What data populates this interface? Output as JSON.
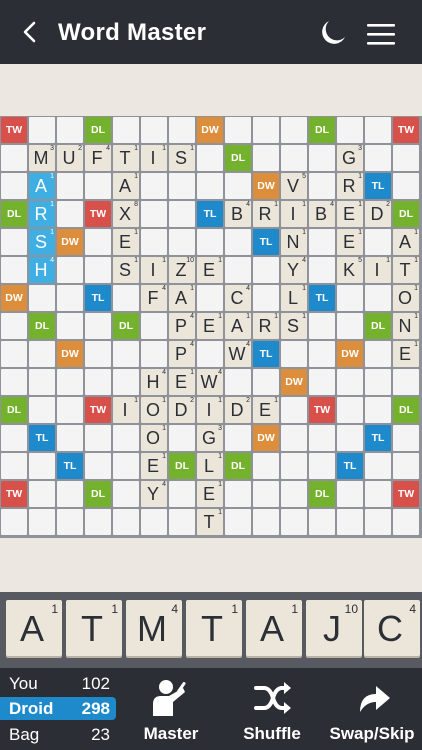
{
  "header": {
    "title": "Word Master",
    "back_icon": "chevron-left-icon",
    "theme_icon": "moon-icon",
    "menu_icon": "hamburger-menu-icon"
  },
  "board": {
    "size": 15,
    "colors": {
      "triple_word": "#d8504a",
      "double_word": "#dd8e3c",
      "triple_letter": "#1e8acb",
      "double_letter": "#74b12d",
      "last_move": "#3faee3",
      "tile": "#ece6da",
      "empty": "#f4f4f4"
    },
    "bonus_labels": {
      "tw": "TW",
      "dw": "DW",
      "tl": "TL",
      "dl": "DL"
    },
    "bonus_rows": [
      "tw . . dl . . . dw . . . dl . . tw",
      ". . . . . . . . dl . . . . . .",
      ". . . . . . . . . dw . . . tl .",
      "dl . . tw . . . tl . . . . . . dl",
      ". . dw . . . . . . tl . . . . .",
      ". dl . . dl . . . . . . . . dl .",
      "dw . . tl . . . . . . . tl . . .",
      ". dl . . dl . . . . . dl . . dl .",
      ". . dw . . . . . . tl . . dw . .",
      ". . . . . . . . . . dw . . . .",
      "dl . . tw . . . . . . . tw . . dl",
      ". tl . . . . . . . dw . . . tl .",
      ". . tl . . . dl . dl . . . tl . .",
      "tw . . dl . . . . . . . dl . . tw",
      ". . . . . . . . . . . . . . ."
    ],
    "blue_cells": [
      [
        2,
        1
      ],
      [
        3,
        1
      ],
      [
        4,
        1
      ],
      [
        5,
        1
      ]
    ],
    "tiles": [
      {
        "r": 1,
        "c": 1,
        "l": "M",
        "p": "3"
      },
      {
        "r": 1,
        "c": 2,
        "l": "U",
        "p": "2"
      },
      {
        "r": 1,
        "c": 3,
        "l": "F",
        "p": "4"
      },
      {
        "r": 1,
        "c": 4,
        "l": "T",
        "p": "1"
      },
      {
        "r": 1,
        "c": 5,
        "l": "I",
        "p": "1"
      },
      {
        "r": 1,
        "c": 6,
        "l": "S",
        "p": "1"
      },
      {
        "r": 1,
        "c": 12,
        "l": "G",
        "p": "3"
      },
      {
        "r": 2,
        "c": 1,
        "l": "A",
        "p": "1"
      },
      {
        "r": 2,
        "c": 4,
        "l": "A",
        "p": "1"
      },
      {
        "r": 2,
        "c": 10,
        "l": "V",
        "p": "5"
      },
      {
        "r": 2,
        "c": 12,
        "l": "R",
        "p": "1"
      },
      {
        "r": 3,
        "c": 1,
        "l": "R",
        "p": "1"
      },
      {
        "r": 3,
        "c": 4,
        "l": "X",
        "p": "8"
      },
      {
        "r": 3,
        "c": 8,
        "l": "B",
        "p": "4"
      },
      {
        "r": 3,
        "c": 9,
        "l": "R",
        "p": "1"
      },
      {
        "r": 3,
        "c": 10,
        "l": "I",
        "p": "1"
      },
      {
        "r": 3,
        "c": 11,
        "l": "B",
        "p": "4"
      },
      {
        "r": 3,
        "c": 12,
        "l": "E",
        "p": "1"
      },
      {
        "r": 3,
        "c": 13,
        "l": "D",
        "p": "2"
      },
      {
        "r": 4,
        "c": 1,
        "l": "S",
        "p": "1"
      },
      {
        "r": 4,
        "c": 4,
        "l": "E",
        "p": "1"
      },
      {
        "r": 4,
        "c": 10,
        "l": "N",
        "p": "1"
      },
      {
        "r": 4,
        "c": 12,
        "l": "E",
        "p": "1"
      },
      {
        "r": 4,
        "c": 14,
        "l": "A",
        "p": "1"
      },
      {
        "r": 5,
        "c": 1,
        "l": "H",
        "p": "4"
      },
      {
        "r": 5,
        "c": 4,
        "l": "S",
        "p": "1"
      },
      {
        "r": 5,
        "c": 5,
        "l": "I",
        "p": "1"
      },
      {
        "r": 5,
        "c": 6,
        "l": "Z",
        "p": "10"
      },
      {
        "r": 5,
        "c": 7,
        "l": "E",
        "p": "1"
      },
      {
        "r": 5,
        "c": 10,
        "l": "Y",
        "p": "4"
      },
      {
        "r": 5,
        "c": 12,
        "l": "K",
        "p": "5"
      },
      {
        "r": 5,
        "c": 13,
        "l": "I",
        "p": "1"
      },
      {
        "r": 5,
        "c": 14,
        "l": "T",
        "p": "1"
      },
      {
        "r": 6,
        "c": 5,
        "l": "F",
        "p": "4"
      },
      {
        "r": 6,
        "c": 6,
        "l": "A",
        "p": "1"
      },
      {
        "r": 6,
        "c": 8,
        "l": "C",
        "p": "4"
      },
      {
        "r": 6,
        "c": 10,
        "l": "L",
        "p": "1"
      },
      {
        "r": 6,
        "c": 14,
        "l": "O",
        "p": "1"
      },
      {
        "r": 7,
        "c": 6,
        "l": "P",
        "p": "4"
      },
      {
        "r": 7,
        "c": 7,
        "l": "E",
        "p": "1"
      },
      {
        "r": 7,
        "c": 8,
        "l": "A",
        "p": "1"
      },
      {
        "r": 7,
        "c": 9,
        "l": "R",
        "p": "1"
      },
      {
        "r": 7,
        "c": 10,
        "l": "S",
        "p": "1"
      },
      {
        "r": 7,
        "c": 14,
        "l": "N",
        "p": "1"
      },
      {
        "r": 8,
        "c": 6,
        "l": "P",
        "p": "4"
      },
      {
        "r": 8,
        "c": 8,
        "l": "W",
        "p": "4"
      },
      {
        "r": 8,
        "c": 14,
        "l": "E",
        "p": "1"
      },
      {
        "r": 9,
        "c": 5,
        "l": "H",
        "p": "4"
      },
      {
        "r": 9,
        "c": 6,
        "l": "E",
        "p": "1"
      },
      {
        "r": 9,
        "c": 7,
        "l": "W",
        "p": "4"
      },
      {
        "r": 10,
        "c": 4,
        "l": "I",
        "p": "1"
      },
      {
        "r": 10,
        "c": 5,
        "l": "O",
        "p": "1"
      },
      {
        "r": 10,
        "c": 6,
        "l": "D",
        "p": "2"
      },
      {
        "r": 10,
        "c": 7,
        "l": "I",
        "p": "1"
      },
      {
        "r": 10,
        "c": 8,
        "l": "D",
        "p": "2"
      },
      {
        "r": 10,
        "c": 9,
        "l": "E",
        "p": "1"
      },
      {
        "r": 11,
        "c": 5,
        "l": "O",
        "p": "1"
      },
      {
        "r": 11,
        "c": 7,
        "l": "G",
        "p": "3"
      },
      {
        "r": 12,
        "c": 5,
        "l": "E",
        "p": "1"
      },
      {
        "r": 12,
        "c": 7,
        "l": "L",
        "p": "1"
      },
      {
        "r": 13,
        "c": 5,
        "l": "Y",
        "p": "4"
      },
      {
        "r": 13,
        "c": 7,
        "l": "E",
        "p": "1"
      },
      {
        "r": 14,
        "c": 7,
        "l": "T",
        "p": "1"
      }
    ]
  },
  "rack": [
    {
      "letter": "A",
      "points": "1"
    },
    {
      "letter": "T",
      "points": "1"
    },
    {
      "letter": "M",
      "points": "4"
    },
    {
      "letter": "T",
      "points": "1"
    },
    {
      "letter": "A",
      "points": "1"
    },
    {
      "letter": "J",
      "points": "10"
    },
    {
      "letter": "C",
      "points": "4"
    }
  ],
  "scores": {
    "you_label": "You",
    "you": "102",
    "droid_label": "Droid",
    "droid": "298",
    "bag_label": "Bag",
    "bag": "23",
    "active_color": "#1e8acb"
  },
  "actions": {
    "master_label": "Master",
    "master_icon": "master-person-icon",
    "shuffle_label": "Shuffle",
    "shuffle_icon": "shuffle-icon",
    "swap_label": "Swap/Skip",
    "swap_icon": "swap-arrow-icon"
  }
}
